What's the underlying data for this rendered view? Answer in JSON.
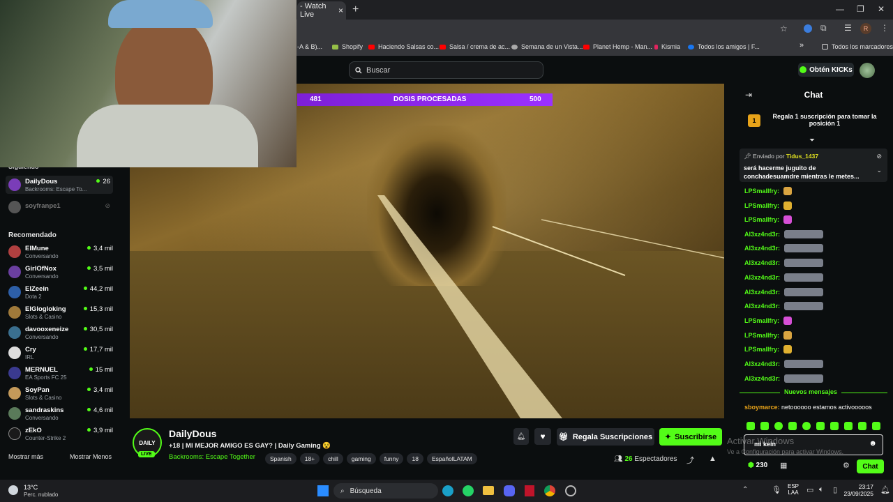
{
  "browser": {
    "tab_title": "- Watch Live",
    "tab_close": "×",
    "new_tab": "+",
    "bookmarks": [
      {
        "label": "-A & B)...",
        "color": "#888888"
      },
      {
        "label": "Shopify",
        "color": "#95bf47"
      },
      {
        "label": "Haciendo Salsas co...",
        "color": "#ff0000"
      },
      {
        "label": "Salsa / crema de ac...",
        "color": "#ff0000"
      },
      {
        "label": "Semana de un Vista...",
        "color": "#aaaaaa"
      },
      {
        "label": "Planet Hemp - Man...",
        "color": "#ff0000"
      },
      {
        "label": "Kismia",
        "color": "#e0245e"
      },
      {
        "label": "Todos los amigos | F...",
        "color": "#1877f2"
      }
    ],
    "bookmarks_more": "»",
    "all_bookmarks": "Todos los marcadores",
    "profile_initial": "R"
  },
  "header": {
    "search_placeholder": "Buscar",
    "get_kicks": "Obtén KICKs"
  },
  "sidebar": {
    "following_title": "Siguiendo",
    "following": [
      {
        "name": "DailyDous",
        "category": "Backrooms: Escape To...",
        "viewers": "26",
        "color": "#7a3db8"
      },
      {
        "name": "soyfranpe1",
        "category": "",
        "viewers": "",
        "color": "#555555"
      }
    ],
    "recommended_title": "Recomendado",
    "recommended": [
      {
        "name": "ElMune",
        "category": "Conversando",
        "viewers": "3,4 mil",
        "color": "#b04040"
      },
      {
        "name": "GirlOfNox",
        "category": "Conversando",
        "viewers": "3,5 mil",
        "color": "#6a3fa0"
      },
      {
        "name": "ElZeein",
        "category": "Dota 2",
        "viewers": "44,2 mil",
        "color": "#2d5fa8"
      },
      {
        "name": "ElGlogloking",
        "category": "Slots & Casino",
        "viewers": "15,3 mil",
        "color": "#a07a3a"
      },
      {
        "name": "davooxeneize",
        "category": "Conversando",
        "viewers": "30,5 mil",
        "color": "#3a6f8f"
      },
      {
        "name": "Cry",
        "category": "IRL",
        "viewers": "17,7 mil",
        "color": "#dddddd"
      },
      {
        "name": "MERNUEL",
        "category": "EA Sports FC 25",
        "viewers": "15 mil",
        "color": "#3a3a8f"
      },
      {
        "name": "SoyPan",
        "category": "Slots & Casino",
        "viewers": "3,4 mil",
        "color": "#c49a5a"
      },
      {
        "name": "sandraskins",
        "category": "Conversando",
        "viewers": "4,6 mil",
        "color": "#5a7a5a"
      },
      {
        "name": "zEkO",
        "category": "Counter-Strike 2",
        "viewers": "3,9 mil",
        "color": "#1a1a1a"
      }
    ],
    "show_more": "Mostrar más",
    "show_less": "Mostrar Menos"
  },
  "overlay": {
    "left": "481",
    "label": "DOSIS PROCESADAS",
    "right": "500"
  },
  "stream": {
    "channel": "DailyDous",
    "avatar_text": "DAILY",
    "live": "LIVE",
    "title": "+18 | MI MEJOR AMIGO ES GAY? | Daily Gaming 😵",
    "category": "Backrooms: Escape Together",
    "tags": [
      "Spanish",
      "18+",
      "chill",
      "gaming",
      "funny",
      "18",
      "EspañolLATAM"
    ],
    "gift_subs": "Regala Suscripciones",
    "subscribe": "Suscribirse",
    "viewers": "26",
    "viewers_label": "Espectadores"
  },
  "chat": {
    "title": "Chat",
    "pinned_badge": "1",
    "pinned_text": "Regala 1 suscripción para tomar la posición 1",
    "sent_by_label": "Enviado por",
    "sent_by_user": "Tidus_1437",
    "sent_text": "será hacerme juguito de conchadesuamdre mientras le metes...",
    "messages": [
      {
        "user": "LPSmallfry:",
        "emote_color": "#d9a441"
      },
      {
        "user": "LPSmallfry:",
        "emote_color": "#e0b030"
      },
      {
        "user": "LPSmallfry:",
        "emote_color": "#d64fd6"
      },
      {
        "user": "Al3xz4nd3r:",
        "emote_color": "#7a7f8a"
      },
      {
        "user": "Al3xz4nd3r:",
        "emote_color": "#7a7f8a"
      },
      {
        "user": "Al3xz4nd3r:",
        "emote_color": "#7a7f8a"
      },
      {
        "user": "Al3xz4nd3r:",
        "emote_color": "#7a7f8a"
      },
      {
        "user": "Al3xz4nd3r:",
        "emote_color": "#7a7f8a"
      },
      {
        "user": "Al3xz4nd3r:",
        "emote_color": "#7a7f8a"
      },
      {
        "user": "LPSmallfry:",
        "emote_color": "#d64fd6"
      },
      {
        "user": "LPSmallfry:",
        "emote_color": "#d9a441"
      },
      {
        "user": "LPSmallfry:",
        "emote_color": "#e0b030"
      },
      {
        "user": "Al3xz4nd3r:",
        "emote_color": "#7a7f8a"
      },
      {
        "user": "Al3xz4nd3r:",
        "emote_color": "#7a7f8a"
      }
    ],
    "new_messages": "Nuevos mensajes",
    "last_user": "sboymarce:",
    "last_text": "netoooooo estamos activooooos",
    "input_value": "mi kein",
    "kicks_count": "230",
    "send": "Chat"
  },
  "watermark": {
    "line1": "Activar Windows",
    "line2": "Ve a Configuración para activar Windows."
  },
  "taskbar": {
    "temp": "13°C",
    "weather": "Perc. nublado",
    "search": "Búsqueda",
    "lang1": "ESP",
    "lang2": "LAA",
    "time": "23:17",
    "date": "23/09/2025"
  },
  "colors": {
    "kick_green": "#53fc18",
    "overlay_purple": "#9b30ff",
    "background": "#0b0e0f"
  }
}
